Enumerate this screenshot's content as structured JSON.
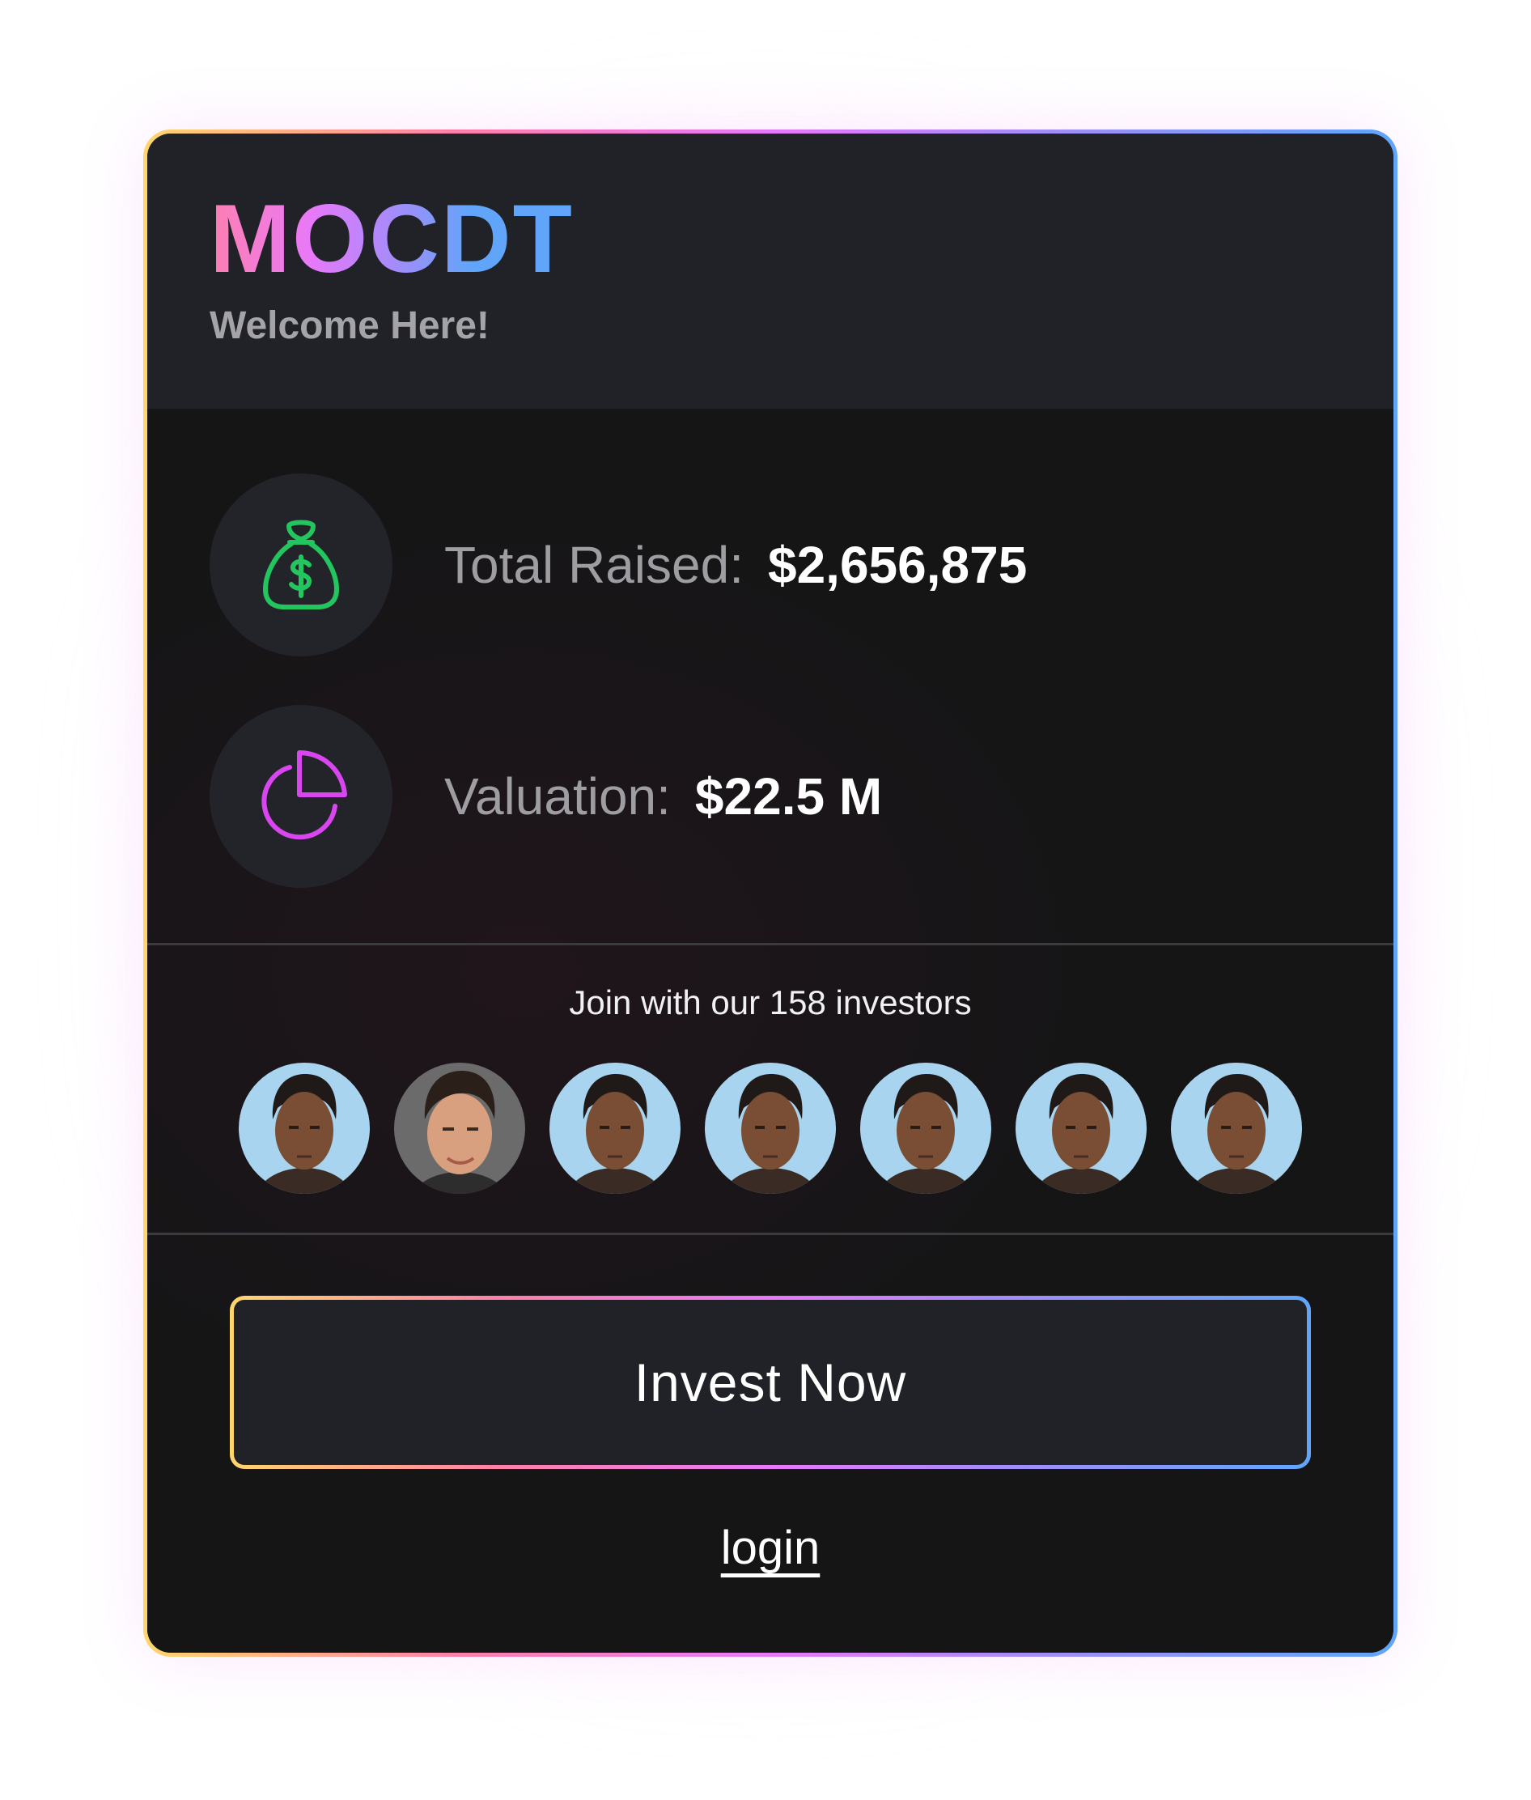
{
  "brand": {
    "name": "MOCDT",
    "welcome": "Welcome Here!"
  },
  "stats": {
    "raised_label": "Total Raised:",
    "raised_value": "$2,656,875",
    "valuation_label": "Valuation:",
    "valuation_value": "$22.5 M"
  },
  "investors": {
    "text": "Join with our 158 investors",
    "avatars": [
      "investor-avatar",
      "investor-avatar",
      "investor-avatar",
      "investor-avatar",
      "investor-avatar",
      "investor-avatar",
      "investor-avatar"
    ]
  },
  "actions": {
    "invest_label": "Invest Now",
    "login_label": "login"
  },
  "colors": {
    "card_bg": "#151516",
    "header_bg": "#212227",
    "money_icon": "#22c55e",
    "pie_icon": "#d946ef",
    "gradient": [
      "#ffd66b",
      "#ff7fa8",
      "#e879f9",
      "#a78bfa",
      "#60a5fa"
    ]
  },
  "icons": {
    "raised": "money-bag-icon",
    "valuation": "pie-chart-icon"
  }
}
